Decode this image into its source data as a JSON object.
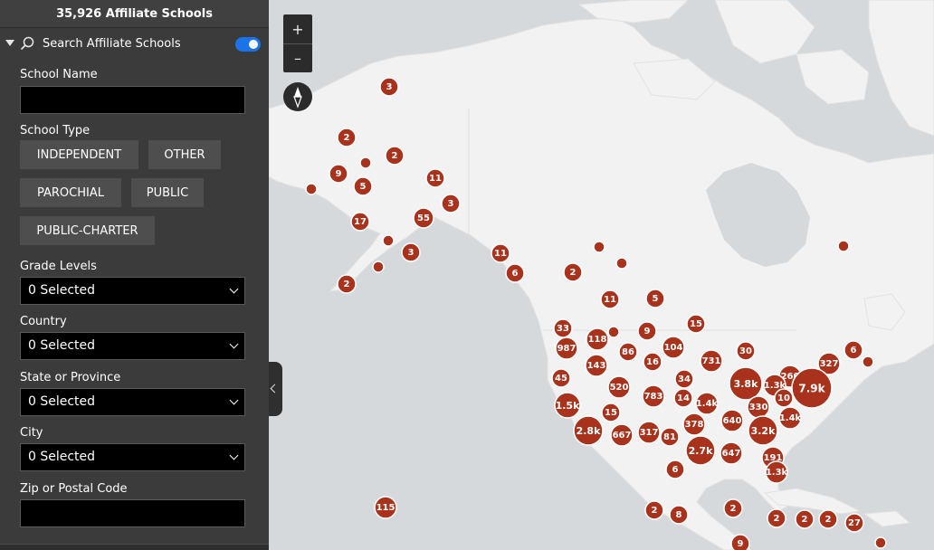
{
  "header": {
    "title": "35,926 Affiliate Schools"
  },
  "search": {
    "label": "Search Affiliate Schools",
    "toggle_on": true
  },
  "fields": {
    "school_name": {
      "label": "School Name",
      "value": ""
    },
    "school_type": {
      "label": "School Type",
      "options": [
        "INDEPENDENT",
        "OTHER",
        "PAROCHIAL",
        "PUBLIC",
        "PUBLIC-CHARTER"
      ]
    },
    "grade_levels": {
      "label": "Grade Levels",
      "value": "0 Selected"
    },
    "country": {
      "label": "Country",
      "value": "0 Selected"
    },
    "state": {
      "label": "State or Province",
      "value": "0 Selected"
    },
    "city": {
      "label": "City",
      "value": "0 Selected"
    },
    "zip": {
      "label": "Zip or Postal Code",
      "value": ""
    }
  },
  "map_controls": {
    "zoom_in": "+",
    "zoom_out": "–"
  },
  "colors": {
    "cluster": "#a8321b",
    "sidebar": "#3b3b3b",
    "toggle": "#1a73e8",
    "land": "#f2f2f2",
    "water": "#d6d9db"
  },
  "clusters": [
    {
      "label": "3"
    },
    {
      "label": "2"
    },
    {
      "label": "2"
    },
    {
      "label": ""
    },
    {
      "label": "9"
    },
    {
      "label": "5"
    },
    {
      "label": "11"
    },
    {
      "label": "3"
    },
    {
      "label": ""
    },
    {
      "label": "17"
    },
    {
      "label": "55"
    },
    {
      "label": ""
    },
    {
      "label": "3"
    },
    {
      "label": ""
    },
    {
      "label": "2"
    },
    {
      "label": "11"
    },
    {
      "label": "6"
    },
    {
      "label": "2"
    },
    {
      "label": ""
    },
    {
      "label": ""
    },
    {
      "label": "11"
    },
    {
      "label": "5"
    },
    {
      "label": ""
    },
    {
      "label": "33"
    },
    {
      "label": "15"
    },
    {
      "label": "987"
    },
    {
      "label": "118"
    },
    {
      "label": ""
    },
    {
      "label": "9"
    },
    {
      "label": "86"
    },
    {
      "label": "104"
    },
    {
      "label": "30"
    },
    {
      "label": "6"
    },
    {
      "label": ""
    },
    {
      "label": "45"
    },
    {
      "label": "143"
    },
    {
      "label": "16"
    },
    {
      "label": "731"
    },
    {
      "label": "34"
    },
    {
      "label": "260"
    },
    {
      "label": "327"
    },
    {
      "label": "520"
    },
    {
      "label": "3.8k"
    },
    {
      "label": "1.3k"
    },
    {
      "label": "7.9k"
    },
    {
      "label": "783"
    },
    {
      "label": "14"
    },
    {
      "label": "1.4k"
    },
    {
      "label": "10"
    },
    {
      "label": "1.5k"
    },
    {
      "label": "330"
    },
    {
      "label": "15"
    },
    {
      "label": "640"
    },
    {
      "label": "1.4k"
    },
    {
      "label": "2.8k"
    },
    {
      "label": "667"
    },
    {
      "label": "317"
    },
    {
      "label": "81"
    },
    {
      "label": "378"
    },
    {
      "label": "3.2k"
    },
    {
      "label": "2.7k"
    },
    {
      "label": "647"
    },
    {
      "label": "191"
    },
    {
      "label": "6"
    },
    {
      "label": "1.3k"
    },
    {
      "label": "115"
    },
    {
      "label": "2"
    },
    {
      "label": "8"
    },
    {
      "label": "2"
    },
    {
      "label": "2"
    },
    {
      "label": "2"
    },
    {
      "label": "2"
    },
    {
      "label": "27"
    },
    {
      "label": "9"
    },
    {
      "label": ""
    }
  ]
}
